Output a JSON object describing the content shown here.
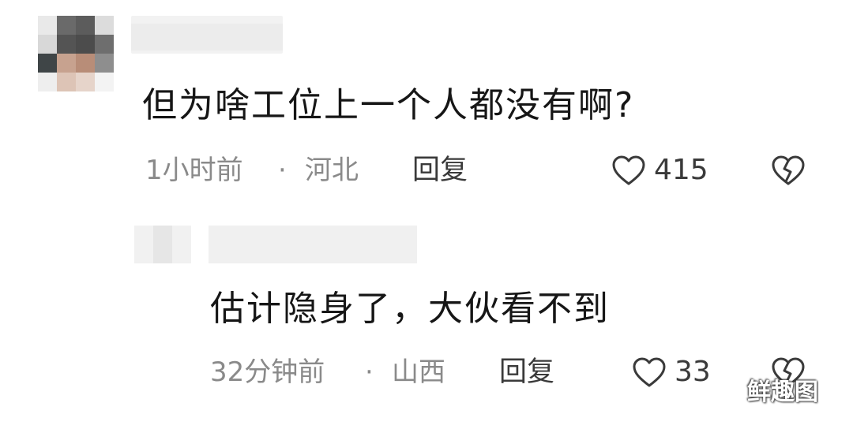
{
  "comments": [
    {
      "text": "但为啥工位上一个人都没有啊?",
      "time": "1小时前",
      "separator": "·",
      "location": "河北",
      "reply_label": "回复",
      "like_count": "415"
    },
    {
      "text": "估计隐身了，大伙看不到",
      "time": "32分钟前",
      "separator": "·",
      "location": "山西",
      "reply_label": "回复",
      "like_count": "33"
    }
  ],
  "watermark": "鲜趣图",
  "icons": {
    "like": "heart-outline-icon",
    "dislike": "broken-heart-icon"
  }
}
